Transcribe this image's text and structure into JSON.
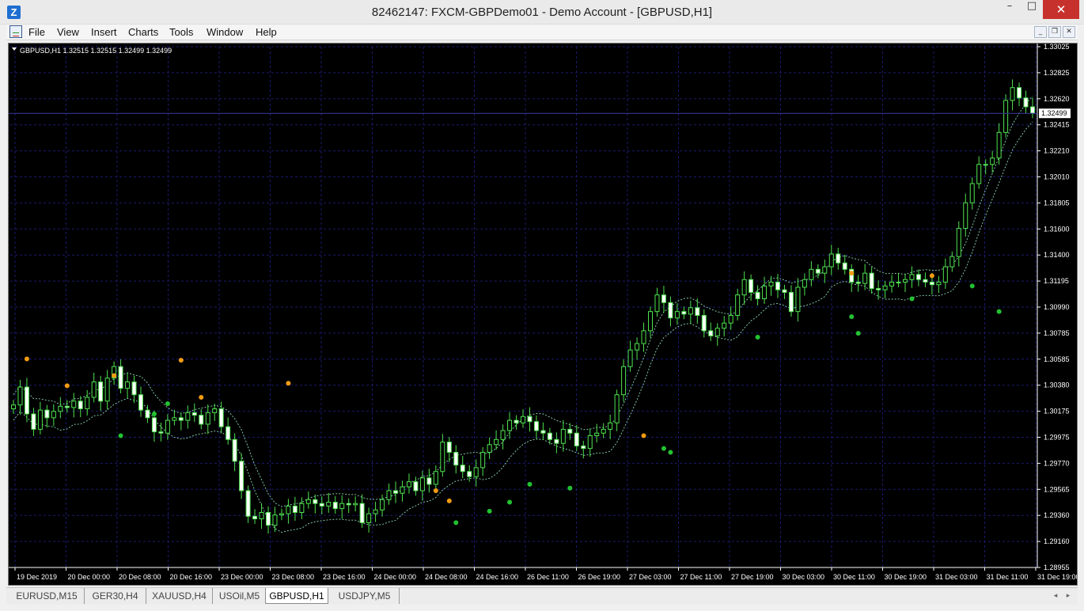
{
  "window": {
    "title": "82462147: FXCM-GBPDemo01 - Demo Account - [GBPUSD,H1]",
    "app_icon": "metatrader-icon",
    "controls": {
      "minimize": "–",
      "maximize": "□",
      "close": "✕"
    }
  },
  "menu": {
    "items": [
      "File",
      "View",
      "Insert",
      "Charts",
      "Tools",
      "Window",
      "Help"
    ],
    "mdi_controls": [
      "_",
      "❐",
      "✕"
    ]
  },
  "chart_data": {
    "type": "candlestick",
    "info_label": "GBPUSD,H1  1.32515 1.32515 1.32499 1.32499",
    "current_price": "1.32499",
    "ylim": [
      1.2895,
      1.3302
    ],
    "y_ticks": [
      "1.33025",
      "1.32825",
      "1.32620",
      "1.32415",
      "1.32210",
      "1.32010",
      "1.31805",
      "1.31600",
      "1.31400",
      "1.31195",
      "1.30990",
      "1.30785",
      "1.30585",
      "1.30380",
      "1.30175",
      "1.29975",
      "1.29770",
      "1.29565",
      "1.29360",
      "1.29160",
      "1.28955"
    ],
    "x_ticks": [
      "19 Dec 2019",
      "20 Dec 00:00",
      "20 Dec 08:00",
      "20 Dec 16:00",
      "23 Dec 00:00",
      "23 Dec 08:00",
      "23 Dec 16:00",
      "24 Dec 00:00",
      "24 Dec 08:00",
      "24 Dec 16:00",
      "26 Dec 11:00",
      "26 Dec 19:00",
      "27 Dec 03:00",
      "27 Dec 11:00",
      "27 Dec 19:00",
      "30 Dec 03:00",
      "30 Dec 11:00",
      "30 Dec 19:00",
      "31 Dec 03:00",
      "31 Dec 11:00",
      "31 Dec 19:00"
    ],
    "price_path": [
      1.3022,
      1.3036,
      1.3015,
      1.3003,
      1.3018,
      1.3012,
      1.3017,
      1.3021,
      1.302,
      1.3025,
      1.3019,
      1.3028,
      1.304,
      1.3025,
      1.3043,
      1.3052,
      1.3035,
      1.304,
      1.303,
      1.3018,
      1.3012,
      1.3001,
      1.3,
      1.301,
      1.3012,
      1.301,
      1.3016,
      1.3014,
      1.3007,
      1.3016,
      1.3019,
      1.3005,
      1.2995,
      1.2978,
      1.2955,
      1.2935,
      1.2933,
      1.2938,
      1.2928,
      1.2936,
      1.2937,
      1.2943,
      1.2938,
      1.2945,
      1.2948,
      1.2945,
      1.2943,
      1.2946,
      1.2941,
      1.2945,
      1.2944,
      1.2945,
      1.293,
      1.2937,
      1.294,
      1.2948,
      1.2955,
      1.2953,
      1.2958,
      1.2962,
      1.2955,
      1.2965,
      1.296,
      1.297,
      1.2993,
      1.2985,
      1.2975,
      1.297,
      1.2966,
      1.2973,
      1.2985,
      1.2991,
      1.2995,
      1.3002,
      1.301,
      1.3008,
      1.3013,
      1.3009,
      1.3002,
      1.3,
      1.2995,
      1.2992,
      1.3003,
      1.3,
      1.299,
      1.2988,
      1.2998,
      1.3,
      1.3003,
      1.3008,
      1.303,
      1.3052,
      1.3065,
      1.307,
      1.308,
      1.3095,
      1.3108,
      1.3102,
      1.309,
      1.3095,
      1.3093,
      1.3098,
      1.3092,
      1.308,
      1.3076,
      1.3082,
      1.3086,
      1.3092,
      1.3108,
      1.312,
      1.311,
      1.3105,
      1.3115,
      1.3118,
      1.3112,
      1.311,
      1.3095,
      1.3114,
      1.312,
      1.3128,
      1.3125,
      1.313,
      1.314,
      1.3133,
      1.3128,
      1.3118,
      1.3117,
      1.3125,
      1.3113,
      1.3112,
      1.3115,
      1.3118,
      1.3118,
      1.312,
      1.3124,
      1.312,
      1.3118,
      1.3116,
      1.3118,
      1.313,
      1.3138,
      1.316,
      1.318,
      1.3195,
      1.321,
      1.321,
      1.3215,
      1.3235,
      1.326,
      1.327,
      1.3262,
      1.3255,
      1.325
    ],
    "fractal_up": [
      [
        2,
        1.3058
      ],
      [
        8,
        1.3037
      ],
      [
        15,
        1.3045
      ],
      [
        25,
        1.3057
      ],
      [
        28,
        1.3028
      ],
      [
        41,
        1.3039
      ],
      [
        63,
        1.2955
      ],
      [
        65,
        1.2947
      ],
      [
        94,
        1.2998
      ],
      [
        125,
        1.3125
      ],
      [
        137,
        1.3123
      ]
    ],
    "fractal_down": [
      [
        16,
        1.2998
      ],
      [
        21,
        1.3015
      ],
      [
        23,
        1.3023
      ],
      [
        66,
        1.293
      ],
      [
        71,
        1.2939
      ],
      [
        74,
        1.2946
      ],
      [
        77,
        1.296
      ],
      [
        83,
        1.2957
      ],
      [
        97,
        1.2988
      ],
      [
        98,
        1.2985
      ],
      [
        111,
        1.3075
      ],
      [
        125,
        1.3091
      ],
      [
        126,
        1.3078
      ],
      [
        134,
        1.3105
      ],
      [
        143,
        1.3115
      ],
      [
        147,
        1.3095
      ]
    ],
    "colors": {
      "bg": "#000000",
      "grid": "#1a1a6e",
      "bull_fill": "#000000",
      "bull_stroke": "#4ee34e",
      "bear_fill": "#ffffff",
      "wick": "#4ee34e",
      "fractal_up": "#f39c12",
      "fractal_down": "#22c232",
      "envelope": "#8fd9b6",
      "axis_text": "#ffffff",
      "price_line": "#3a3aa0"
    }
  },
  "tabs": [
    "EURUSD,M15",
    "GER30,H4",
    "XAUUSD,H4",
    "USOil,M5",
    "GBPUSD,H1",
    "USDJPY,M5"
  ],
  "active_tab": "GBPUSD,H1",
  "tab_scroll": {
    "left": "◂",
    "right": "▸"
  }
}
